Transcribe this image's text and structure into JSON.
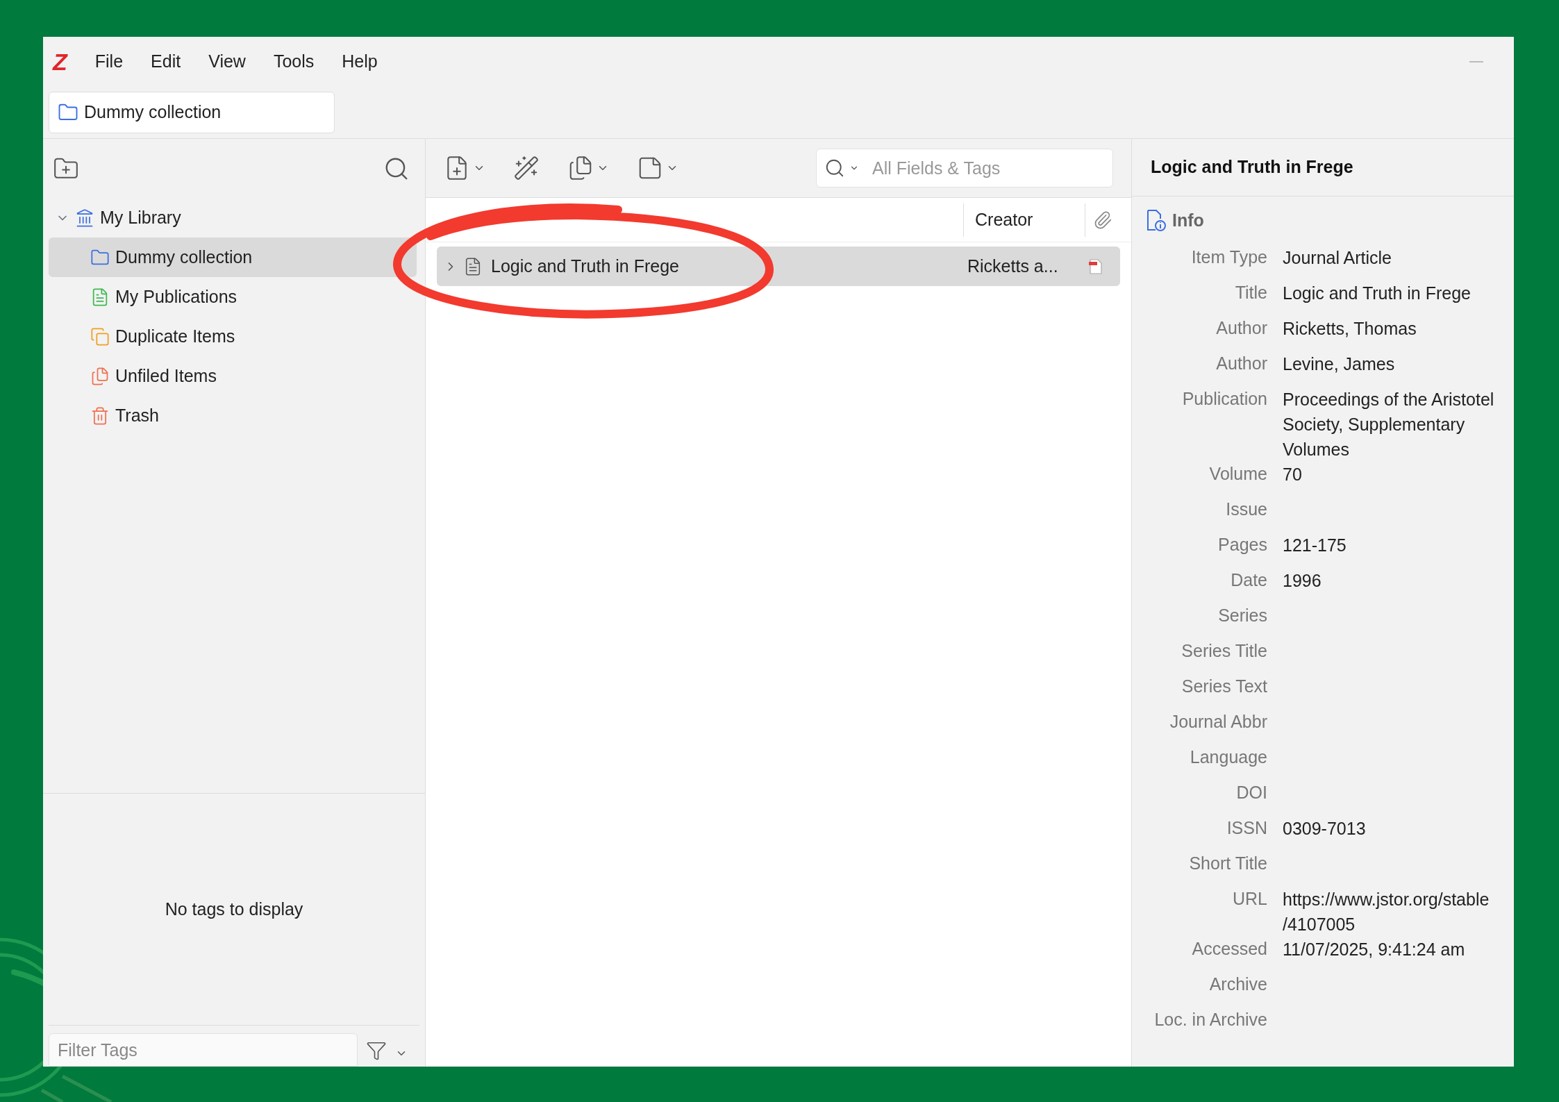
{
  "app": {
    "logo": "Z",
    "menu": [
      "File",
      "Edit",
      "View",
      "Tools",
      "Help"
    ]
  },
  "tabs": [
    {
      "label": "Dummy collection",
      "selected": true
    }
  ],
  "collections": [
    {
      "label": "My Library",
      "kind": "library",
      "expanded": true,
      "selected": false,
      "children": [
        {
          "label": "Dummy collection",
          "kind": "folder",
          "selected": true
        },
        {
          "label": "My Publications",
          "kind": "publications",
          "selected": false
        },
        {
          "label": "Duplicate Items",
          "kind": "duplicates",
          "selected": false
        },
        {
          "label": "Unfiled Items",
          "kind": "unfiled",
          "selected": false
        },
        {
          "label": "Trash",
          "kind": "trash",
          "selected": false
        }
      ]
    }
  ],
  "tags": {
    "empty_message": "No tags to display",
    "filter_placeholder": "Filter Tags"
  },
  "search": {
    "placeholder": "All Fields & Tags"
  },
  "items": {
    "columns": [
      "Creator"
    ],
    "rows": [
      {
        "title": "Logic and Truth in Frege",
        "creator": "Ricketts a...",
        "selected": true,
        "expanded": false,
        "attachment": {
          "kind": "pdf"
        }
      }
    ]
  },
  "item_pane": {
    "title": "Logic and Truth in Frege",
    "section": "Info",
    "fields": [
      {
        "label": "Item Type",
        "value": [
          "Journal Article"
        ]
      },
      {
        "label": "Title",
        "value": [
          "Logic and Truth in Frege"
        ]
      },
      {
        "label": "Author",
        "value": [
          "Ricketts, Thomas"
        ]
      },
      {
        "label": "Author",
        "value": [
          "Levine, James"
        ]
      },
      {
        "label": "Publication",
        "value": [
          "Proceedings of the Aristotel",
          "Society, Supplementary",
          "Volumes"
        ]
      },
      {
        "label": "Volume",
        "value": [
          "70"
        ]
      },
      {
        "label": "Issue"
      },
      {
        "label": "Pages",
        "value": [
          "121-175"
        ]
      },
      {
        "label": "Date",
        "value": [
          "1996"
        ]
      },
      {
        "label": "Series"
      },
      {
        "label": "Series Title"
      },
      {
        "label": "Series Text"
      },
      {
        "label": "Journal Abbr"
      },
      {
        "label": "Language"
      },
      {
        "label": "DOI"
      },
      {
        "label": "ISSN",
        "value": [
          "0309-7013"
        ]
      },
      {
        "label": "Short Title"
      },
      {
        "label": "URL",
        "value": [
          "https://www.jstor.org/stable",
          "/4107005"
        ]
      },
      {
        "label": "Accessed",
        "value": [
          "11/07/2025, 9:41:24 am"
        ]
      },
      {
        "label": "Archive"
      },
      {
        "label": "Loc. in Archive"
      }
    ]
  }
}
